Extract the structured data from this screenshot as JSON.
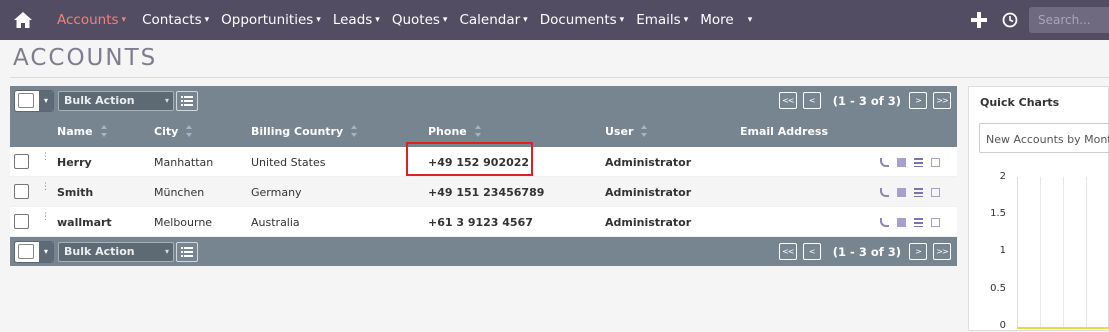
{
  "nav": {
    "items": [
      {
        "label": "Accounts",
        "active": true
      },
      {
        "label": "Contacts"
      },
      {
        "label": "Opportunities"
      },
      {
        "label": "Leads"
      },
      {
        "label": "Quotes"
      },
      {
        "label": "Calendar"
      },
      {
        "label": "Documents"
      },
      {
        "label": "Emails"
      },
      {
        "label": "More"
      }
    ],
    "search_placeholder": "Search..."
  },
  "page": {
    "title": "ACCOUNTS"
  },
  "toolbar": {
    "bulk_label": "Bulk Action",
    "pagination": {
      "first": "<<",
      "prev": "<",
      "next": ">",
      "last": ">>",
      "count_text": "(1 - 3 of 3)"
    }
  },
  "columns": [
    "Name",
    "City",
    "Billing Country",
    "Phone",
    "User",
    "Email Address"
  ],
  "rows": [
    {
      "name": "Herry",
      "city": "Manhattan",
      "country": "United States",
      "phone": "+49 152 902022",
      "user": "Administrator"
    },
    {
      "name": "Smith",
      "city": "München",
      "country": "Germany",
      "phone": "+49 151 23456789",
      "user": "Administrator"
    },
    {
      "name": "wallmart",
      "city": "Melbourne",
      "country": "Australia",
      "phone": "+61 3 9123 4567",
      "user": "Administrator"
    }
  ],
  "quick_charts": {
    "title": "Quick Charts",
    "selected_chart": "New Accounts by Month",
    "yticks": [
      "2",
      "1.5",
      "1",
      "0.5",
      "0"
    ]
  },
  "colors": {
    "nav_bg": "#534d64",
    "accent": "#f08377",
    "bar_bg": "#778591"
  }
}
